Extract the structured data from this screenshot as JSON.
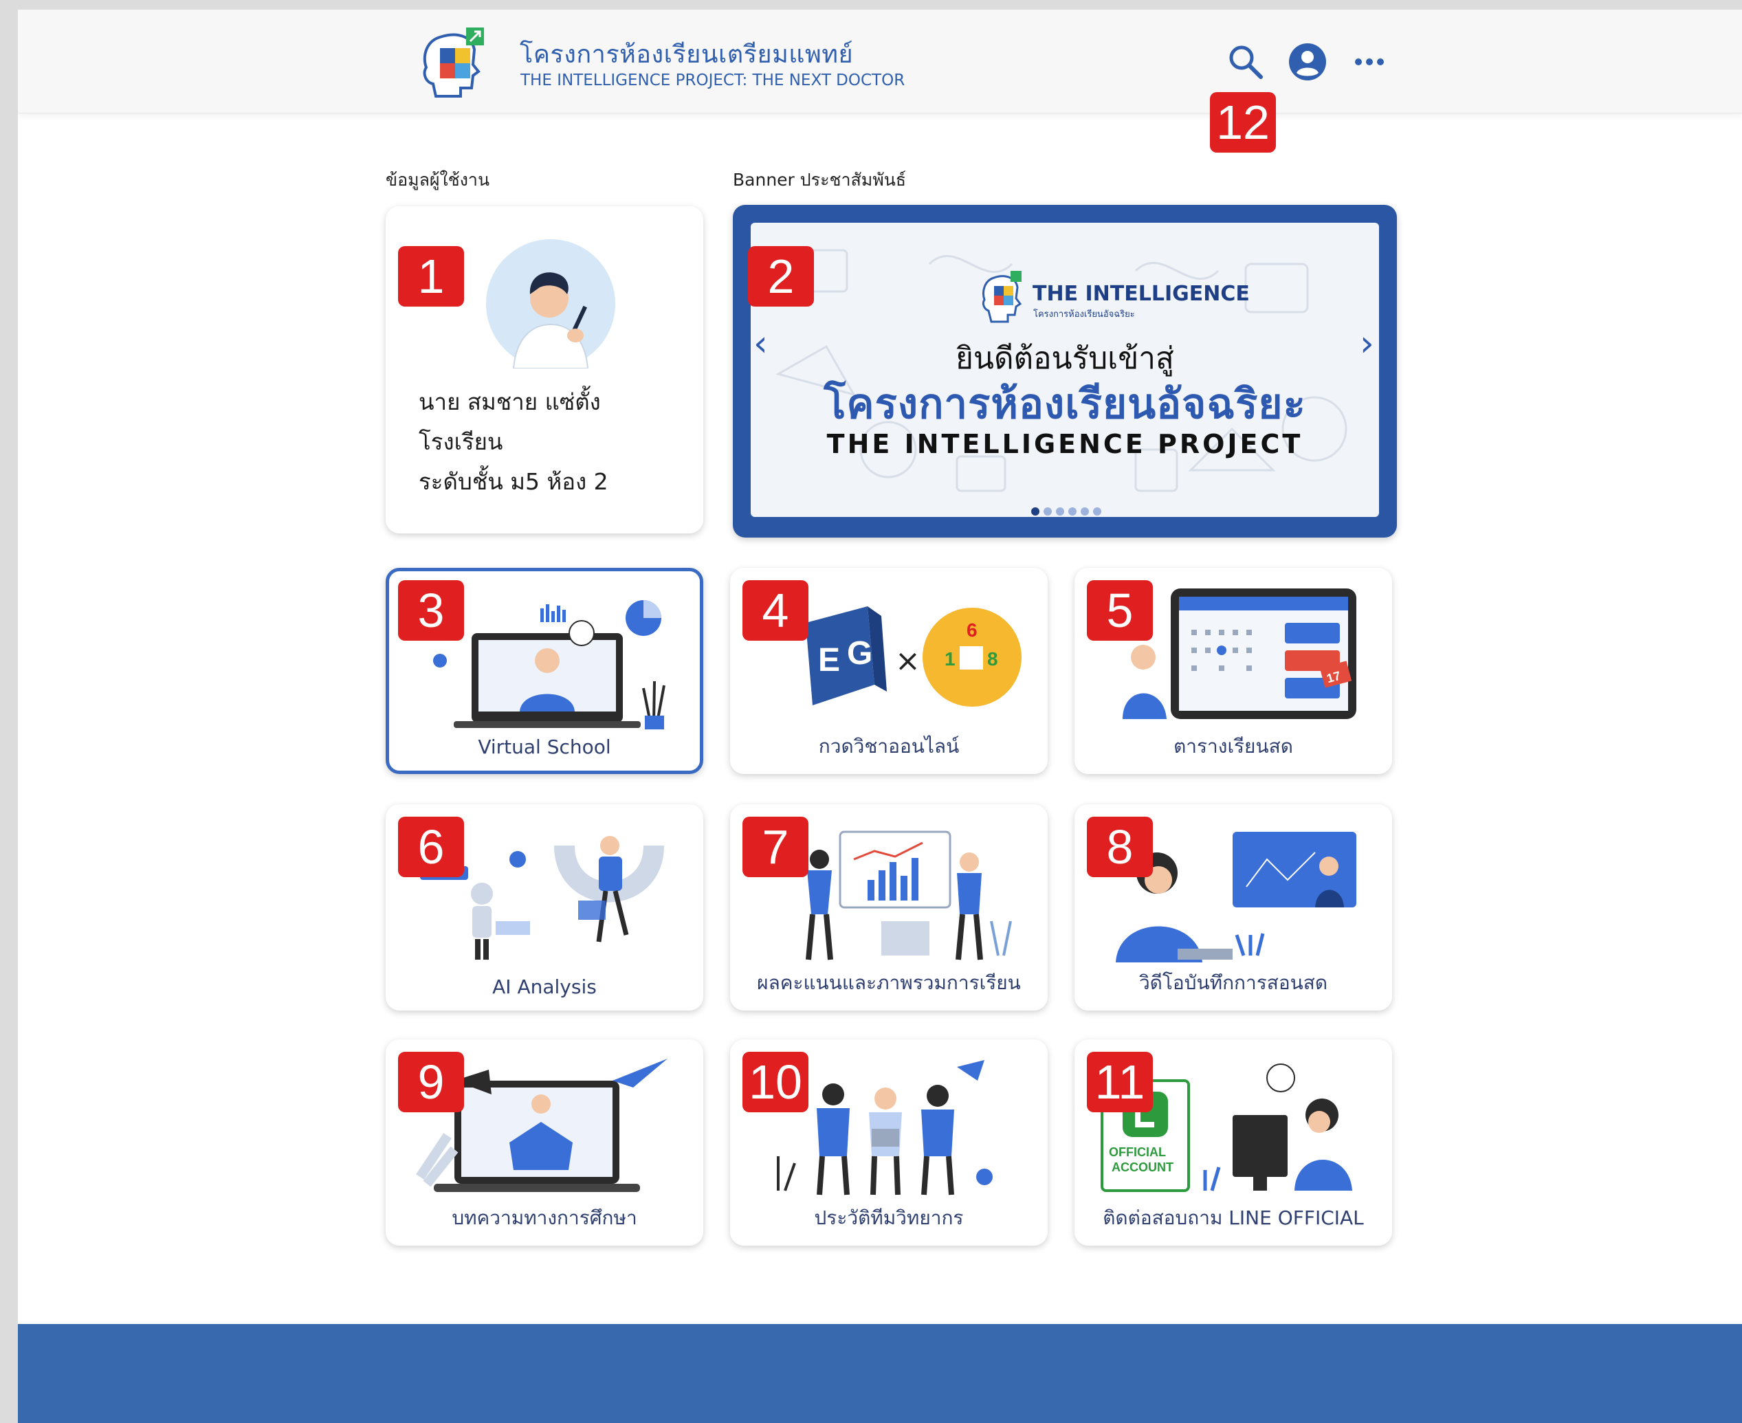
{
  "header": {
    "title": "โครงการห้องเรียนเตรียมแพทย์",
    "subtitle": "THE INTELLIGENCE PROJECT: THE NEXT DOCTOR",
    "icons": [
      "search-icon",
      "user-account-icon",
      "more-options-icon"
    ]
  },
  "sections": {
    "user_info_label": "ข้อมูลผู้ใช้งาน",
    "banner_label": "Banner ประชาสัมพันธ์"
  },
  "profile": {
    "name": "นาย สมชาย แซ่ตั้ง",
    "school": "โรงเรียน",
    "class_level": "ระดับชั้น ม5 ห้อง 2"
  },
  "banner": {
    "logo_title": "THE INTELLIGENCE",
    "logo_subtitle": "โครงการห้องเรียนอัจฉริยะ",
    "welcome": "ยินดีต้อนรับเข้าสู่",
    "title": "โครงการห้องเรียนอัจฉริยะ",
    "subtitle": "THE INTELLIGENCE PROJECT",
    "prev_arrow": "‹",
    "next_arrow": "›",
    "slide_count": 6,
    "active_slide": 1
  },
  "tiles": [
    {
      "label": "Virtual School",
      "badge": "3",
      "selected": true
    },
    {
      "label": "กวดวิชาออนไลน์",
      "badge": "4",
      "art_text": [
        "E",
        "G",
        "×",
        "6",
        "1",
        "8"
      ]
    },
    {
      "label": "ตารางเรียนสด",
      "badge": "5",
      "art_text": [
        "17"
      ]
    },
    {
      "label": "AI Analysis",
      "badge": "6"
    },
    {
      "label": "ผลคะแนนและภาพรวมการเรียน",
      "badge": "7"
    },
    {
      "label": "วิดีโอบันทึกการสอนสด",
      "badge": "8"
    },
    {
      "label": "บทความทางการศึกษา",
      "badge": "9"
    },
    {
      "label": "ประวัติทีมวิทยากร",
      "badge": "10"
    },
    {
      "label": "ติดต่อสอบถาม LINE OFFICIAL",
      "badge": "11",
      "art_text": [
        "OFFICIAL",
        "ACCOUNT"
      ]
    }
  ],
  "badges": {
    "profile": "1",
    "banner": "2",
    "header_icons": "12"
  },
  "colors": {
    "brand_blue": "#2f5fae",
    "footer_blue": "#3868ad",
    "badge_red": "#e02020",
    "tile_label": "#2e3f70"
  }
}
